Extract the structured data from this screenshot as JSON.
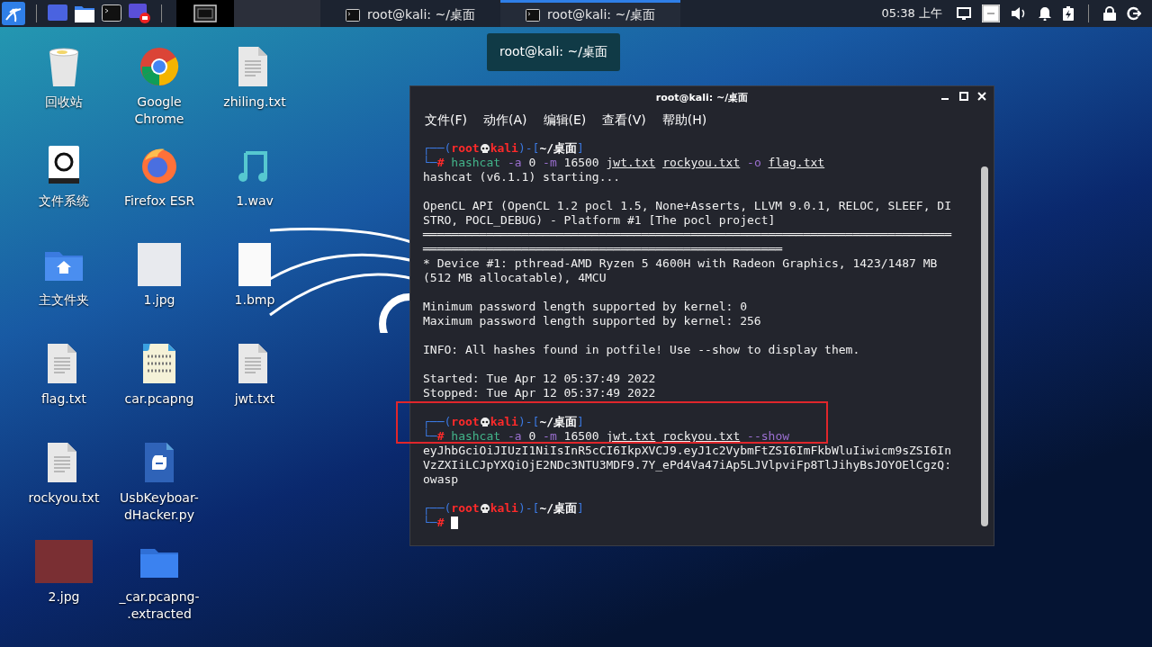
{
  "taskbar": {
    "tasks": [
      {
        "title": "root@kali: ~/桌面",
        "selected": false
      },
      {
        "title": "root@kali: ~/桌面",
        "selected": true
      }
    ],
    "clock": "05:38 上午"
  },
  "tooltip": "root@kali: ~/桌面",
  "desktop_rows": [
    {
      "icons": [
        {
          "label": "回收站",
          "kind": "trash"
        },
        {
          "label": "Google Chrome",
          "kind": "chrome"
        },
        {
          "label": "zhiling.txt",
          "kind": "text"
        }
      ]
    },
    {
      "icons": [
        {
          "label": "文件系统",
          "kind": "drive"
        },
        {
          "label": "Firefox ESR",
          "kind": "firefox"
        },
        {
          "label": "1.wav",
          "kind": "audio"
        }
      ]
    },
    {
      "icons": [
        {
          "label": "主文件夹",
          "kind": "home"
        },
        {
          "label": "1.jpg",
          "kind": "image"
        },
        {
          "label": "1.bmp",
          "kind": "document"
        }
      ]
    },
    {
      "icons": [
        {
          "label": "flag.txt",
          "kind": "text"
        },
        {
          "label": "car.pcapng",
          "kind": "binary"
        },
        {
          "label": "jwt.txt",
          "kind": "text"
        }
      ]
    },
    {
      "icons": [
        {
          "label": "rockyou.txt",
          "kind": "text"
        },
        {
          "label": "UsbKeyboar-dHacker.py",
          "kind": "python"
        }
      ]
    },
    {
      "icons": [
        {
          "label": "2.jpg",
          "kind": "photo"
        },
        {
          "label": "_car.pcapng-.extracted",
          "kind": "folder"
        }
      ]
    }
  ],
  "terminal": {
    "title": "root@kali: ~/桌面",
    "menu": [
      "文件(F)",
      "动作(A)",
      "编辑(E)",
      "查看(V)",
      "帮助(H)"
    ],
    "lines": [
      {
        "kind": "prompt",
        "frame_start": "┌──(",
        "user": "root",
        "host": "kali",
        "frame_mid": ")-[",
        "path": "~/桌面",
        "frame_end": "]"
      },
      {
        "kind": "command",
        "frame": "└─",
        "mark": "#",
        "cursor": false,
        "tokens": [
          {
            "text": "hashcat",
            "kind": "program"
          },
          {
            "text": "-a",
            "kind": "flag"
          },
          {
            "text": "0",
            "kind": "plain"
          },
          {
            "text": "-m",
            "kind": "flag"
          },
          {
            "text": "16500",
            "kind": "plain"
          },
          {
            "text": "jwt.txt",
            "kind": "file"
          },
          {
            "text": "rockyou.txt",
            "kind": "file"
          },
          {
            "text": "-o",
            "kind": "flag"
          },
          {
            "text": "flag.txt",
            "kind": "file"
          }
        ]
      },
      {
        "kind": "output",
        "text": "hashcat (v6.1.1) starting..."
      },
      {
        "kind": "blank"
      },
      {
        "kind": "output",
        "text": "OpenCL API (OpenCL 1.2 pocl 1.5, None+Asserts, LLVM 9.0.1, RELOC, SLEEF, DISTRO, POCL_DEBUG) - Platform #1 [The pocl project]"
      },
      {
        "kind": "output",
        "text": "═══════════════════════════════════════════════════════════════════════════"
      },
      {
        "kind": "output",
        "text": "═══════════════════════════════════════════════════"
      },
      {
        "kind": "output",
        "text": "* Device #1: pthread-AMD Ryzen 5 4600H with Radeon Graphics, 1423/1487 MB (512 MB allocatable), 4MCU"
      },
      {
        "kind": "blank"
      },
      {
        "kind": "output",
        "text": "Minimum password length supported by kernel: 0"
      },
      {
        "kind": "output",
        "text": "Maximum password length supported by kernel: 256"
      },
      {
        "kind": "blank"
      },
      {
        "kind": "output",
        "text": "INFO: All hashes found in potfile! Use --show to display them."
      },
      {
        "kind": "blank"
      },
      {
        "kind": "output",
        "text": "Started: Tue Apr 12 05:37:49 2022"
      },
      {
        "kind": "output",
        "text": "Stopped: Tue Apr 12 05:37:49 2022"
      },
      {
        "kind": "blank"
      },
      {
        "kind": "prompt",
        "frame_start": "┌──(",
        "user": "root",
        "host": "kali",
        "frame_mid": ")-[",
        "path": "~/桌面",
        "frame_end": "]"
      },
      {
        "kind": "command",
        "frame": "└─",
        "mark": "#",
        "cursor": false,
        "tokens": [
          {
            "text": "hashcat",
            "kind": "program"
          },
          {
            "text": "-a",
            "kind": "flag"
          },
          {
            "text": "0",
            "kind": "plain"
          },
          {
            "text": "-m",
            "kind": "flag"
          },
          {
            "text": "16500",
            "kind": "plain"
          },
          {
            "text": "jwt.txt",
            "kind": "file"
          },
          {
            "text": "rockyou.txt",
            "kind": "file"
          },
          {
            "text": "--show",
            "kind": "flag"
          }
        ]
      },
      {
        "kind": "output",
        "text": "eyJhbGciOiJIUzI1NiIsInR5cCI6IkpXVCJ9.eyJ1c2VybmFtZSI6ImFkbWluIiwicm9sZSI6InVzZXIiLCJpYXQiOjE2NDc3NTU3MDF9.7Y_ePd4Va47iAp5LJVlpviFp8TlJihyBsJOYOElCgzQ:owasp"
      },
      {
        "kind": "blank"
      },
      {
        "kind": "prompt",
        "frame_start": "┌──(",
        "user": "root",
        "host": "kali",
        "frame_mid": ")-[",
        "path": "~/桌面",
        "frame_end": "]"
      },
      {
        "kind": "command",
        "frame": "└─",
        "mark": "#",
        "cursor": true
      }
    ]
  }
}
